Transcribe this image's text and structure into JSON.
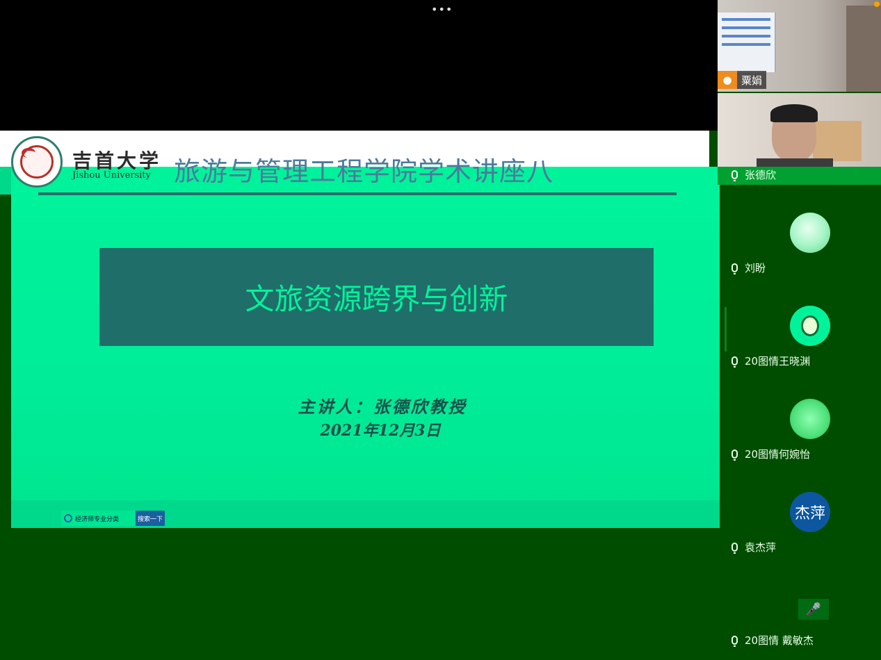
{
  "meeting": {
    "more_label": "•••"
  },
  "slide": {
    "university_name": "吉首大学",
    "university_latin": "Jishou University",
    "lecture_series": "旅游与管理工程学院学术讲座八",
    "title": "文旅资源跨界与创新",
    "speaker": "主讲人：张德欣教授",
    "date": "2021年12月3日",
    "search_text": "经济师专业分类",
    "search_button": "搜索一下"
  },
  "video_tiles": [
    {
      "name": "粟娟",
      "icon": "user-icon"
    },
    {
      "name": "张德欣"
    }
  ],
  "participants": [
    {
      "name": "刘盼",
      "avatar": "cat-photo"
    },
    {
      "name": "20图情王晓渊",
      "avatar": "cartoon"
    },
    {
      "name": "20图情何婉怡",
      "avatar": "plush-bear"
    },
    {
      "name": "袁杰萍",
      "avatar_text": "杰萍"
    },
    {
      "name": "20图情 戴敏杰",
      "avatar": "mic-icon"
    }
  ],
  "colors": {
    "slide_green": "#00f39a",
    "title_box": "#1f6e6a",
    "panel_bg": "#004d00",
    "avatar_blue": "#0d57a0"
  }
}
